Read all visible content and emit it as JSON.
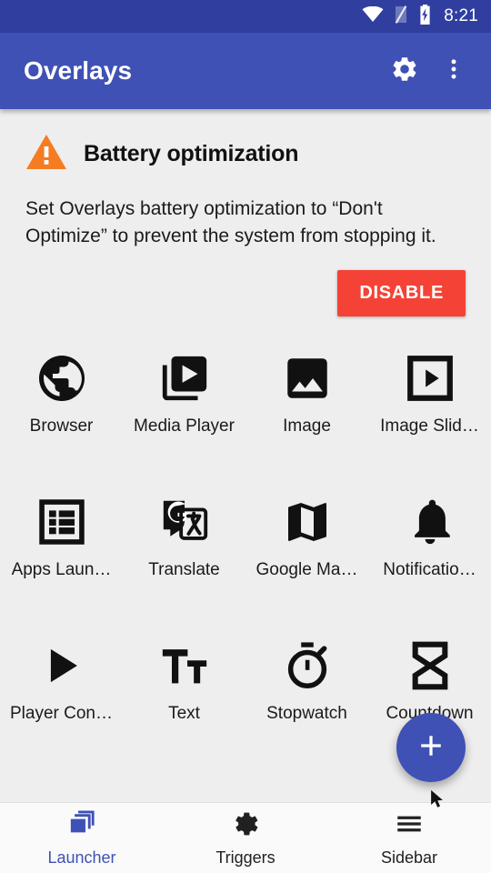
{
  "status_bar": {
    "time": "8:21",
    "icons": [
      "wifi-icon",
      "signal-off-icon",
      "battery-charging-icon"
    ],
    "background_color": "#303f9f"
  },
  "app_bar": {
    "title": "Overlays",
    "background_color": "#3f51b5",
    "actions": [
      {
        "name": "settings-gear-icon",
        "label": "Settings"
      },
      {
        "name": "overflow-menu-icon",
        "label": "More options"
      }
    ]
  },
  "warning_card": {
    "icon": "warning-triangle-icon",
    "icon_color": "#f57c20",
    "title": "Battery optimization",
    "body": "Set Overlays battery optimization to “Don't Optimize” to prevent the system from stopping it.",
    "button_label": "DISABLE",
    "button_color": "#f44336"
  },
  "grid": {
    "items": [
      {
        "label": "Browser",
        "icon": "globe-icon"
      },
      {
        "label": "Media Player",
        "icon": "video-library-icon"
      },
      {
        "label": "Image",
        "icon": "image-icon"
      },
      {
        "label": "Image Slid…",
        "icon": "image-slideshow-icon"
      },
      {
        "label": "Apps Laun…",
        "icon": "apps-list-icon"
      },
      {
        "label": "Translate",
        "icon": "google-translate-icon"
      },
      {
        "label": "Google Ma…",
        "icon": "map-icon"
      },
      {
        "label": "Notificatio…",
        "icon": "bell-icon"
      },
      {
        "label": "Player Con…",
        "icon": "play-arrow-icon"
      },
      {
        "label": "Text",
        "icon": "format-size-icon"
      },
      {
        "label": "Stopwatch",
        "icon": "stopwatch-icon"
      },
      {
        "label": "Countdown",
        "icon": "hourglass-icon"
      }
    ]
  },
  "fab": {
    "icon": "plus-icon",
    "label": "Add overlay",
    "color": "#3f51b5"
  },
  "bottom_nav": {
    "active_color": "#3f51b5",
    "items": [
      {
        "label": "Launcher",
        "icon": "layers-icon",
        "active": true
      },
      {
        "label": "Triggers",
        "icon": "gear-play-icon",
        "active": false
      },
      {
        "label": "Sidebar",
        "icon": "hamburger-icon",
        "active": false
      }
    ]
  }
}
